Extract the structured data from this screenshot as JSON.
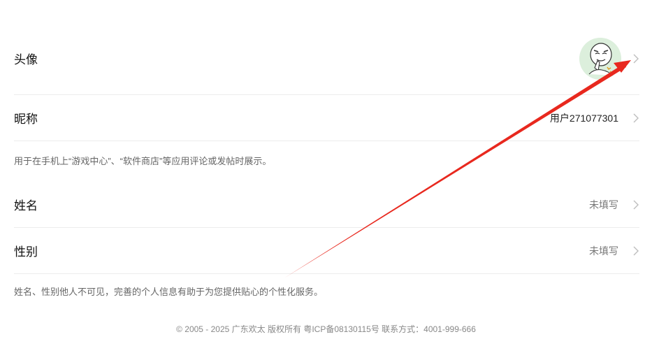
{
  "profile": {
    "avatar_label": "头像",
    "nickname_label": "昵称",
    "nickname_value": "用户271077301",
    "nickname_hint": "用于在手机上“游戏中心”、“软件商店”等应用评论或发帖时展示。",
    "name_label": "姓名",
    "name_value": "未填写",
    "gender_label": "性别",
    "gender_value": "未填写",
    "privacy_hint": "姓名、性别他人不可见，完善的个人信息有助于为您提供贴心的个性化服务。"
  },
  "footer": {
    "text": "© 2005 - 2025 广东欢太 版权所有 粤ICP备08130115号 联系方式：4001-999-666"
  },
  "icons": {
    "chevron": "chevron-right-icon",
    "avatar": "meme-face-avatar"
  },
  "colors": {
    "annotation_arrow": "#e8281e",
    "divider": "#ececec",
    "muted_text": "#777777"
  }
}
